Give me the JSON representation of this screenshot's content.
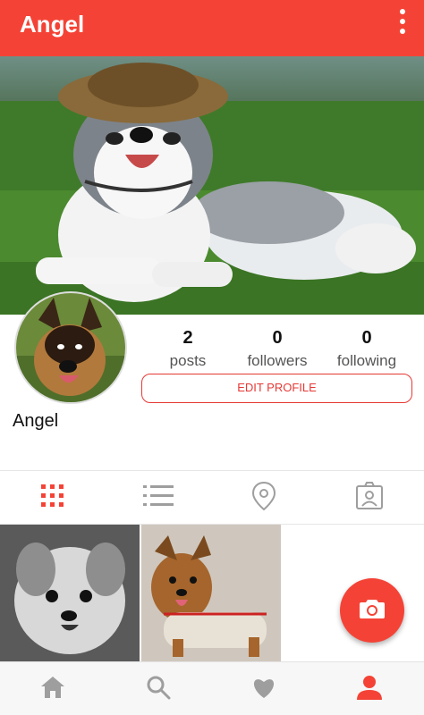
{
  "appbar": {
    "title": "Angel",
    "menu_icon": "more-vert-icon",
    "color": "#f44336"
  },
  "profile": {
    "name": "Angel",
    "stats": [
      {
        "value": "2",
        "label": "posts"
      },
      {
        "value": "0",
        "label": "followers"
      },
      {
        "value": "0",
        "label": "following"
      }
    ],
    "edit_button": "EDIT PROFILE"
  },
  "tabs": [
    {
      "icon": "grid-icon",
      "active": true
    },
    {
      "icon": "list-icon",
      "active": false
    },
    {
      "icon": "location-pin-icon",
      "active": false
    },
    {
      "icon": "tagged-person-icon",
      "active": false
    }
  ],
  "fab": {
    "icon": "camera-icon"
  },
  "bottom_nav": [
    {
      "icon": "home-icon",
      "active": false
    },
    {
      "icon": "search-icon",
      "active": false
    },
    {
      "icon": "heart-icon",
      "active": false
    },
    {
      "icon": "profile-icon",
      "active": true
    }
  ],
  "colors": {
    "accent": "#f44336",
    "inactive_icon": "#9e9e9e"
  }
}
